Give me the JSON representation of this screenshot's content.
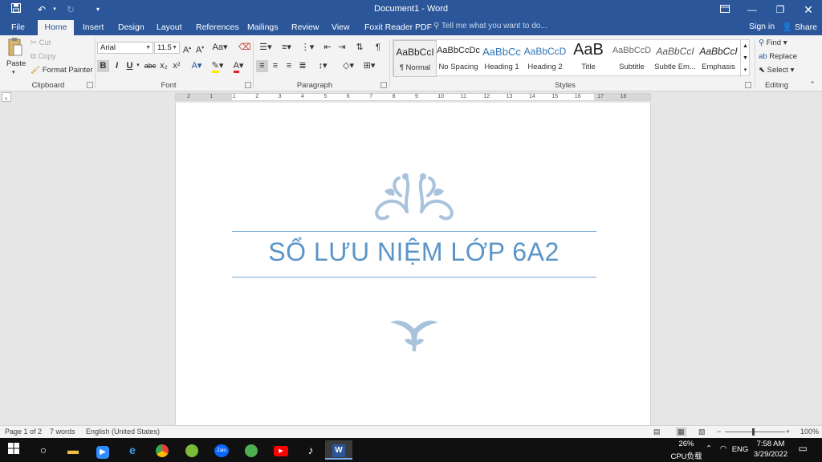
{
  "titlebar": {
    "title": "Document1 - Word",
    "icons": [
      "save-icon",
      "undo-icon",
      "redo-icon",
      "customize-qat-icon",
      "ribbon-display-options-icon",
      "minimize-icon",
      "restore-icon",
      "close-icon"
    ]
  },
  "tabs": {
    "items": [
      "File",
      "Home",
      "Insert",
      "Design",
      "Layout",
      "References",
      "Mailings",
      "Review",
      "View",
      "Foxit Reader PDF"
    ],
    "active": "Home",
    "tell_me": "Tell me what you want to do...",
    "sign_in": "Sign in",
    "share": "Share"
  },
  "clipboard": {
    "paste": "Paste",
    "cut": "Cut",
    "copy": "Copy",
    "format_painter": "Format Painter",
    "label": "Clipboard"
  },
  "font": {
    "name": "Arial",
    "size": "11.5",
    "case": "Aa",
    "bold": "B",
    "italic": "I",
    "underline": "U",
    "strike": "abc",
    "subscript": "x₂",
    "superscript": "x²",
    "label": "Font"
  },
  "paragraph": {
    "label": "Paragraph",
    "pilcrow": "¶"
  },
  "styles": {
    "label": "Styles",
    "items": [
      {
        "preview": "AaBbCcI",
        "name": "¶ Normal"
      },
      {
        "preview": "AaBbCcDc",
        "name": "No Spacing"
      },
      {
        "preview": "AaBbCc",
        "name": "Heading 1"
      },
      {
        "preview": "AaBbCcD",
        "name": "Heading 2"
      },
      {
        "preview": "AaB",
        "name": "Title"
      },
      {
        "preview": "AaBbCcD",
        "name": "Subtitle"
      },
      {
        "preview": "AaBbCcI",
        "name": "Subtle Em..."
      },
      {
        "preview": "AaBbCcI",
        "name": "Emphasis"
      }
    ]
  },
  "editing": {
    "label": "Editing",
    "find": "Find",
    "replace": "Replace",
    "select": "Select"
  },
  "ruler": {
    "ticks": [
      "2",
      "1",
      "1",
      "2",
      "3",
      "4",
      "5",
      "6",
      "7",
      "8",
      "9",
      "10",
      "11",
      "12",
      "13",
      "14",
      "15",
      "16",
      "17",
      "18"
    ]
  },
  "document": {
    "title": "SỔ LƯU NIỆM LỚP 6A2"
  },
  "statusbar": {
    "page": "Page 1 of 2",
    "words": "7 words",
    "language": "English (United States)",
    "zoom": "100%"
  },
  "taskbar": {
    "apps": [
      "windows-start-icon",
      "cortana-icon",
      "file-explorer-icon",
      "zoom-icon",
      "edge-icon",
      "chrome-icon",
      "coccoc-icon",
      "zalo-icon",
      "coccoc-alt-icon",
      "youtube-icon",
      "tiktok-icon",
      "word-icon"
    ],
    "cpu_percent": "26%",
    "cpu_label": "CPU负载",
    "lang": "ENG",
    "time": "7:58 AM",
    "date": "3/29/2022"
  },
  "colors": {
    "brand": "#2b579a",
    "title_text": "#5b95c8",
    "ornament": "#a9c3dd"
  }
}
